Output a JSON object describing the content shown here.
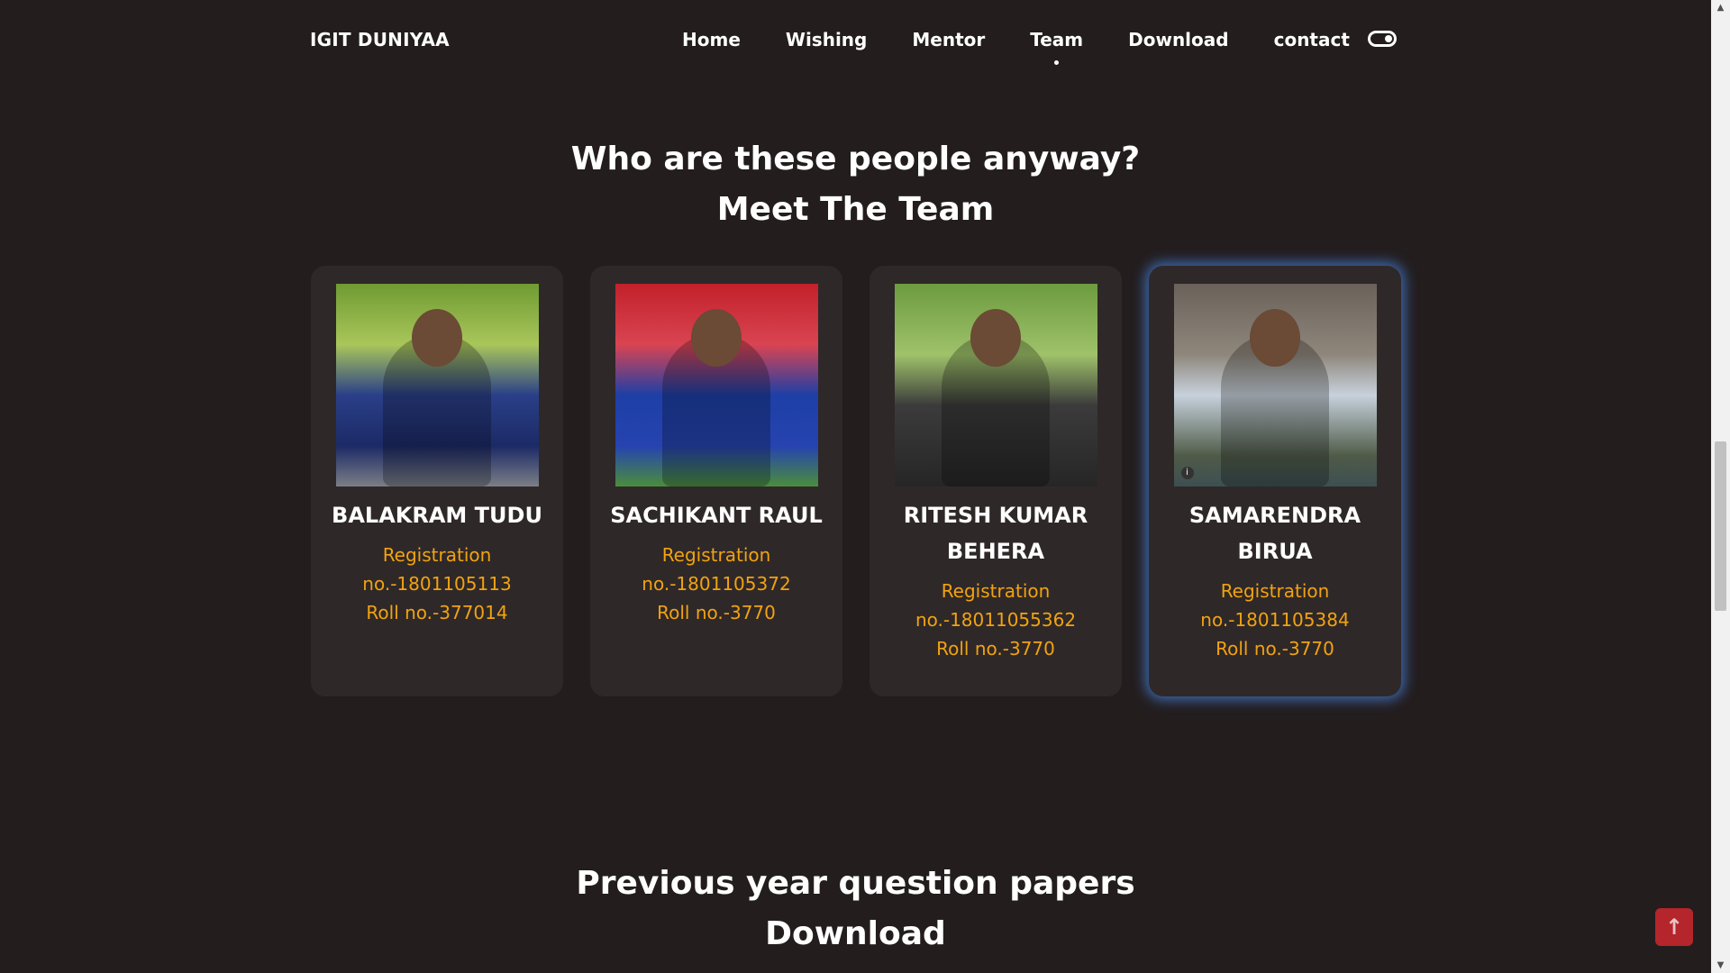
{
  "nav": {
    "brand": "IGIT DUNIYAA",
    "items": [
      {
        "label": "Home"
      },
      {
        "label": "Wishing"
      },
      {
        "label": "Mentor"
      },
      {
        "label": "Team",
        "active": true
      },
      {
        "label": "Download"
      },
      {
        "label": "contact"
      }
    ],
    "theme_toggle": "toggle-icon"
  },
  "team_section": {
    "title_line1": "Who are these people anyway?",
    "title_line2": "Meet The Team",
    "members": [
      {
        "name": "BALAKRAM TUDU",
        "registration": "Registration no.-1801105113",
        "roll": "Roll no.-377014"
      },
      {
        "name": "SACHIKANT RAUL",
        "registration": "Registration no.-1801105372",
        "roll": "Roll no.-3770"
      },
      {
        "name": "RITESH KUMAR BEHERA",
        "registration": "Registration no.-18011055362",
        "roll": "Roll no.-3770"
      },
      {
        "name": "SAMARENDRA BIRUA",
        "registration": "Registration no.-1801105384",
        "roll": "Roll no.-3770"
      }
    ]
  },
  "download_section": {
    "title_line1": "Previous year question papers",
    "title_line2": "Download"
  },
  "back_to_top": "arrow-up-icon",
  "colors": {
    "background": "#231d1e",
    "card": "#2f2829",
    "accent_text": "#f1a310",
    "highlight_glow": "#4682dc",
    "back_to_top": "#b5252c"
  }
}
